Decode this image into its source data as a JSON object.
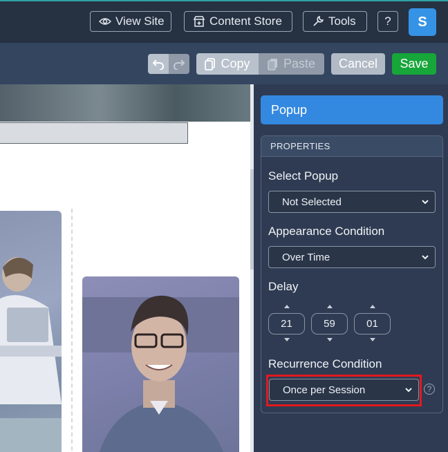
{
  "topbar": {
    "view_site": "View Site",
    "content_store": "Content Store",
    "tools": "Tools",
    "help": "?",
    "avatar_initial": "S"
  },
  "toolbar": {
    "copy": "Copy",
    "paste": "Paste",
    "cancel": "Cancel",
    "save": "Save"
  },
  "panel": {
    "tab": "Popup",
    "section": "PROPERTIES",
    "select_popup_label": "Select Popup",
    "select_popup_value": "Not Selected",
    "appearance_label": "Appearance Condition",
    "appearance_value": "Over Time",
    "delay_label": "Delay",
    "delay_hours": "21",
    "delay_minutes": "59",
    "delay_seconds": "01",
    "recurrence_label": "Recurrence Condition",
    "recurrence_value": "Once per Session",
    "help": "?"
  },
  "colors": {
    "accent": "#3388e0",
    "save": "#17a63a",
    "highlight": "#e3191e",
    "panel_bg": "#2f3b52"
  }
}
